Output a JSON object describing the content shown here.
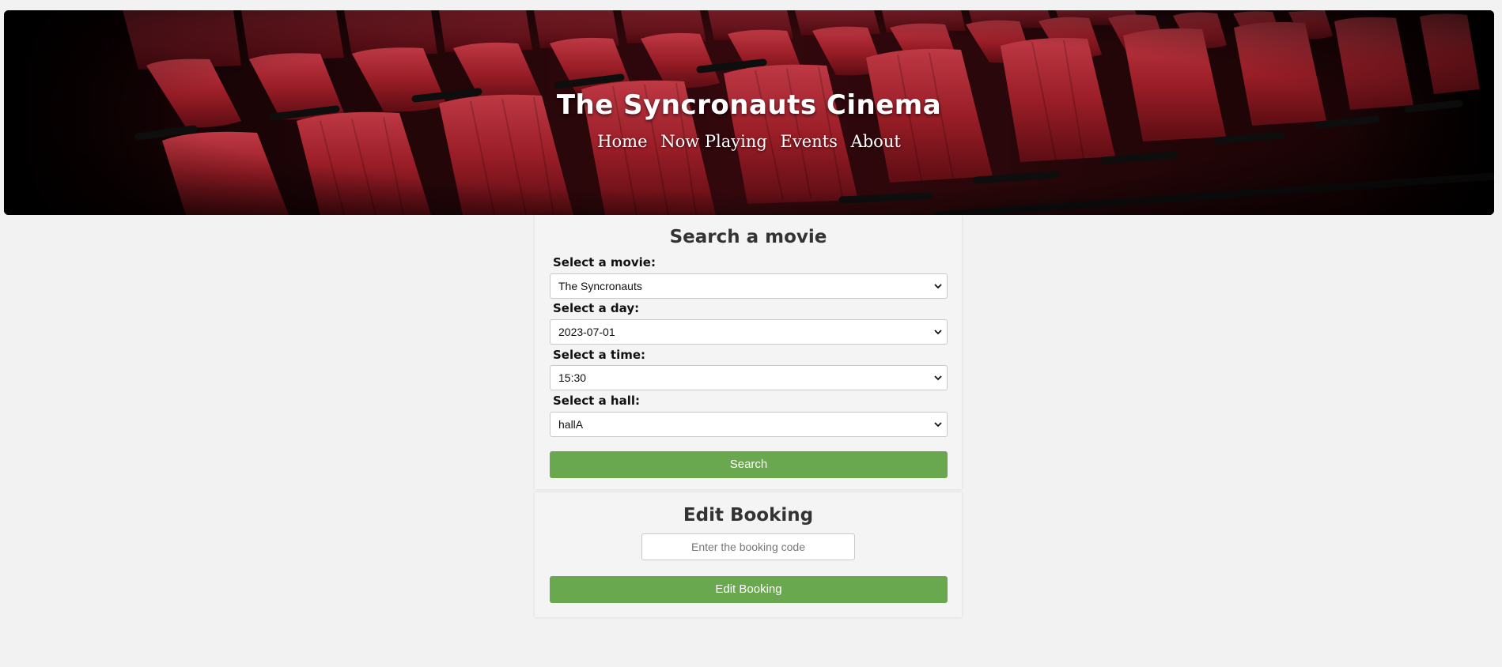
{
  "header": {
    "title": "The Syncronauts Cinema",
    "nav": [
      "Home",
      "Now Playing",
      "Events",
      "About"
    ]
  },
  "search": {
    "heading": "Search a movie",
    "fields": [
      {
        "label": "Select a movie:",
        "value": "The Syncronauts"
      },
      {
        "label": "Select a day:",
        "value": "2023-07-01"
      },
      {
        "label": "Select a time:",
        "value": "15:30"
      },
      {
        "label": "Select a hall:",
        "value": "hallA"
      }
    ],
    "button_label": "Search"
  },
  "edit": {
    "heading": "Edit Booking",
    "placeholder": "Enter the booking code",
    "button_label": "Edit Booking"
  },
  "colors": {
    "page_bg": "#f2f2f2",
    "button_green": "#6aa84f",
    "seat_red": "#b8242f"
  }
}
